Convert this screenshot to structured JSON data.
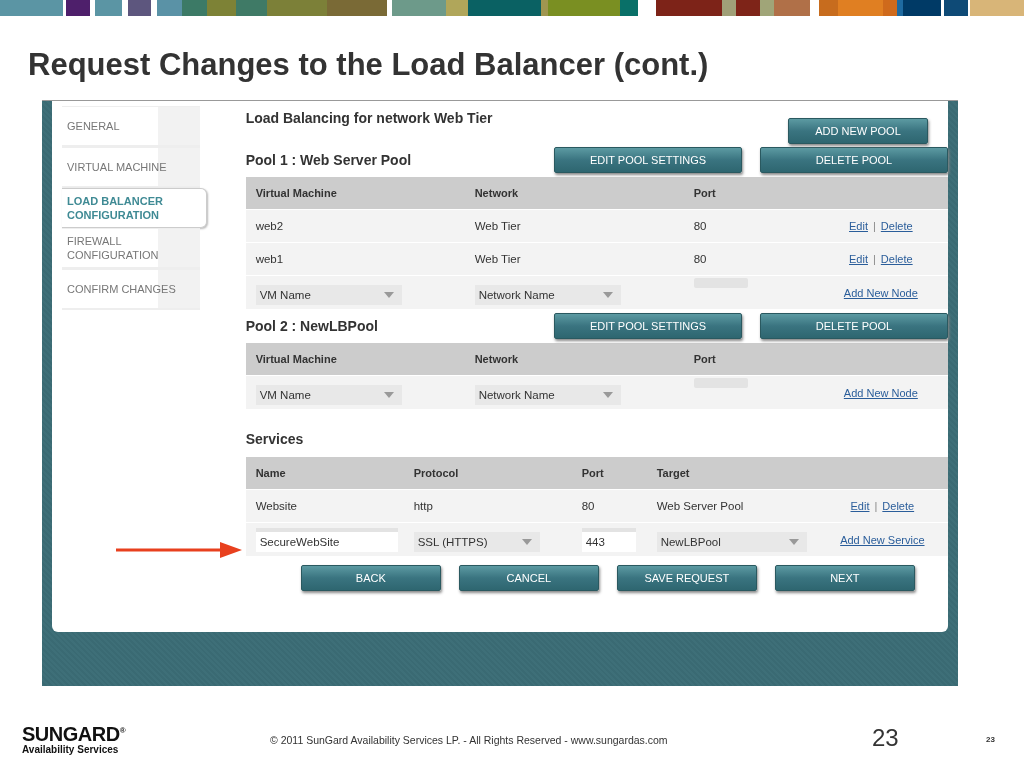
{
  "slide_title": "Request Changes to the Load Balancer (cont.)",
  "sidebar": {
    "items": [
      {
        "label": "GENERAL",
        "selected": false
      },
      {
        "label": "VIRTUAL MACHINE",
        "selected": false
      },
      {
        "label": "LOAD BALANCER CONFIGURATION",
        "selected": true
      },
      {
        "label": "FIREWALL CONFIGURATION",
        "selected": false
      },
      {
        "label": "CONFIRM CHANGES",
        "selected": false
      }
    ]
  },
  "heading": "Load Balancing for network Web Tier",
  "add_pool_button": "ADD NEW POOL",
  "pools": [
    {
      "title": "Pool 1 : Web Server Pool",
      "buttons": [
        "EDIT POOL SETTINGS",
        "DELETE POOL"
      ],
      "columns": [
        "Virtual Machine",
        "Network",
        "Port"
      ],
      "rows": [
        {
          "cells": [
            "web2",
            "Web Tier",
            "80"
          ],
          "actions": [
            "Edit",
            "Delete"
          ],
          "separator": "|"
        },
        {
          "cells": [
            "web1",
            "Web Tier",
            "80"
          ],
          "actions": [
            "Edit",
            "Delete"
          ],
          "separator": "|"
        }
      ],
      "new_row": {
        "vm": "VM Name",
        "network": "Network Name",
        "action": "Add New Node"
      }
    },
    {
      "title": "Pool 2 : NewLBPool",
      "buttons": [
        "EDIT POOL SETTINGS",
        "DELETE POOL"
      ],
      "columns": [
        "Virtual Machine",
        "Network",
        "Port"
      ],
      "new_row": {
        "vm": "VM Name",
        "network": "Network Name",
        "action": "Add New Node"
      }
    }
  ],
  "services": {
    "title": "Services",
    "columns": [
      "Name",
      "Protocol",
      "Port",
      "Target"
    ],
    "rows": [
      {
        "cells": [
          "Website",
          "http",
          "80",
          "Web Server Pool"
        ],
        "actions": [
          "Edit",
          "Delete"
        ],
        "separator": "|"
      }
    ],
    "new_row": {
      "name": "SecureWebSite",
      "protocol": "SSL (HTTPS)",
      "port": "443",
      "target": "NewLBPool",
      "action": "Add New Service"
    }
  },
  "nav_buttons": [
    "BACK",
    "CANCEL",
    "SAVE REQUEST",
    "NEXT"
  ],
  "footer": {
    "logo": {
      "name": "SUNGARD",
      "mark": "®",
      "tagline": "Availability Services"
    },
    "copyright": "© 2011 SunGard Availability Services LP. - All Rights Reserved - www.sungardas.com",
    "page_number": "23",
    "page_number_small": "23"
  }
}
